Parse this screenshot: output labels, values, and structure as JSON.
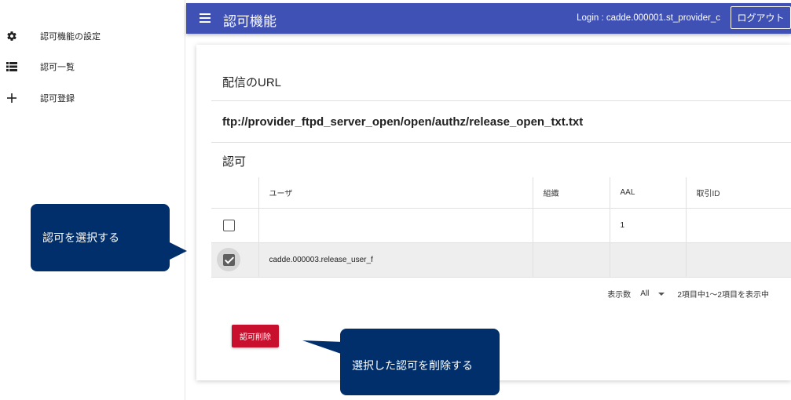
{
  "sidebar": {
    "items": [
      {
        "label": "認可機能の設定",
        "icon": "gear-icon"
      },
      {
        "label": "認可一覧",
        "icon": "list-icon"
      },
      {
        "label": "認可登録",
        "icon": "plus-icon"
      }
    ]
  },
  "appbar": {
    "title": "認可機能",
    "login": "Login : cadde.000001.st_provider_c",
    "logout_label": "ログアウト"
  },
  "main": {
    "url_section_title": "配信のURL",
    "url": "ftp://provider_ftpd_server_open/open/authz/release_open_txt.txt",
    "auth_section_title": "認可",
    "table": {
      "headers": [
        "ユーザ",
        "組織",
        "AAL",
        "取引ID"
      ],
      "rows": [
        {
          "checked": false,
          "user": "",
          "org": "",
          "aal": "1",
          "txid": ""
        },
        {
          "checked": true,
          "user": "cadde.000003.release_user_f",
          "org": "",
          "aal": "",
          "txid": ""
        }
      ]
    },
    "pagination": {
      "per_page_label": "表示数",
      "per_page_value": "All",
      "range_text": "2項目中1〜2項目を表示中"
    },
    "delete_label": "認可削除"
  },
  "callouts": {
    "select": "認可を選択する",
    "delete": "選択した認可を削除する"
  },
  "colors": {
    "appbar": "#3f51b5",
    "delete": "#c8102e",
    "callout": "#002f6c"
  }
}
